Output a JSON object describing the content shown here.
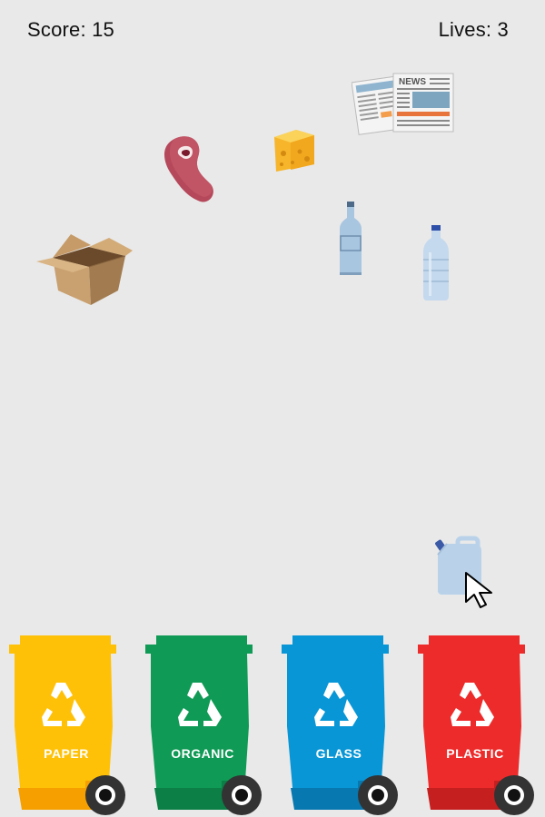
{
  "hud": {
    "score_text": "Score: 15",
    "lives_text": "Lives: 3"
  },
  "items": {
    "newspaper_headline": "NEWS"
  },
  "bins": [
    {
      "label": "PAPER",
      "color": "#ffc107",
      "dark": "#f5a000"
    },
    {
      "label": "ORGANIC",
      "color": "#0f9a55",
      "dark": "#0b7f45"
    },
    {
      "label": "GLASS",
      "color": "#0996d6",
      "dark": "#0778b0"
    },
    {
      "label": "PLASTIC",
      "color": "#ee2b2b",
      "dark": "#c51f1f"
    }
  ]
}
